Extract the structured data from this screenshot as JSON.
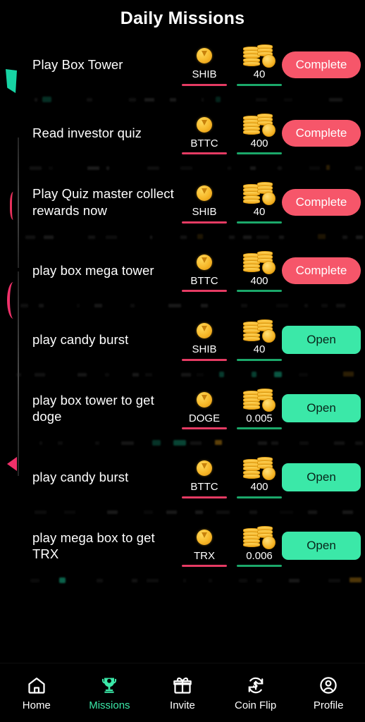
{
  "header": {
    "title": "Daily Missions"
  },
  "missions": [
    {
      "title": "Play Box Tower",
      "token": "SHIB",
      "amount": "40",
      "action": "Complete",
      "state": "complete"
    },
    {
      "title": "Read investor quiz",
      "token": "BTTC",
      "amount": "400",
      "action": "Complete",
      "state": "complete"
    },
    {
      "title": "Play Quiz master collect rewards now",
      "token": "SHIB",
      "amount": "40",
      "action": "Complete",
      "state": "complete"
    },
    {
      "title": "play box mega tower",
      "token": "BTTC",
      "amount": "400",
      "action": "Complete",
      "state": "complete"
    },
    {
      "title": "play candy burst",
      "token": "SHIB",
      "amount": "40",
      "action": "Open",
      "state": "open"
    },
    {
      "title": "play box tower to get doge",
      "token": "DOGE",
      "amount": "0.005",
      "action": "Open",
      "state": "open"
    },
    {
      "title": "play candy burst",
      "token": "BTTC",
      "amount": "400",
      "action": "Open",
      "state": "open"
    },
    {
      "title": "play mega box to get TRX",
      "token": "TRX",
      "amount": "0.006",
      "action": "Open",
      "state": "open"
    }
  ],
  "icons": {
    "token_coin": "gold-coin-icon",
    "reward_coins": "coin-stack-icon"
  },
  "bottom_nav": {
    "items": [
      {
        "label": "Home",
        "icon": "home-icon",
        "active": false
      },
      {
        "label": "Missions",
        "icon": "trophy-icon",
        "active": true
      },
      {
        "label": "Invite",
        "icon": "gift-icon",
        "active": false
      },
      {
        "label": "Coin Flip",
        "icon": "coin-flip-icon",
        "active": false
      },
      {
        "label": "Profile",
        "icon": "profile-icon",
        "active": false
      }
    ]
  },
  "colors": {
    "background": "#000000",
    "accent_green": "#3BE8A8",
    "accent_red": "#F6566A",
    "token_underline": "#E53B63",
    "amount_underline": "#1BA86A",
    "text": "#FFFFFF"
  }
}
